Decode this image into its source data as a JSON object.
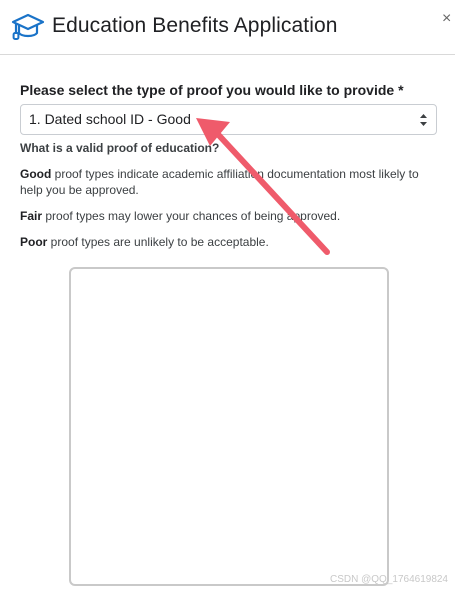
{
  "header": {
    "title": "Education Benefits Application",
    "icon": "graduation-cap-icon",
    "close_glyph": "×"
  },
  "form": {
    "label": "Please select the type of proof you would like to provide *",
    "select_value": "1. Dated school ID - Good"
  },
  "help": {
    "heading": "What is a valid proof of education?",
    "good_label": "Good",
    "good_text": " proof types indicate academic affiliation documentation most likely to help you be approved.",
    "fair_label": "Fair",
    "fair_text": " proof types may lower your chances of being approved.",
    "poor_label": "Poor",
    "poor_text": " proof types are unlikely to be acceptable."
  },
  "watermark": "CSDN @QQ_1764619824",
  "colors": {
    "accent_blue": "#1a73c8",
    "annotation_arrow": "#ef5b6b"
  }
}
